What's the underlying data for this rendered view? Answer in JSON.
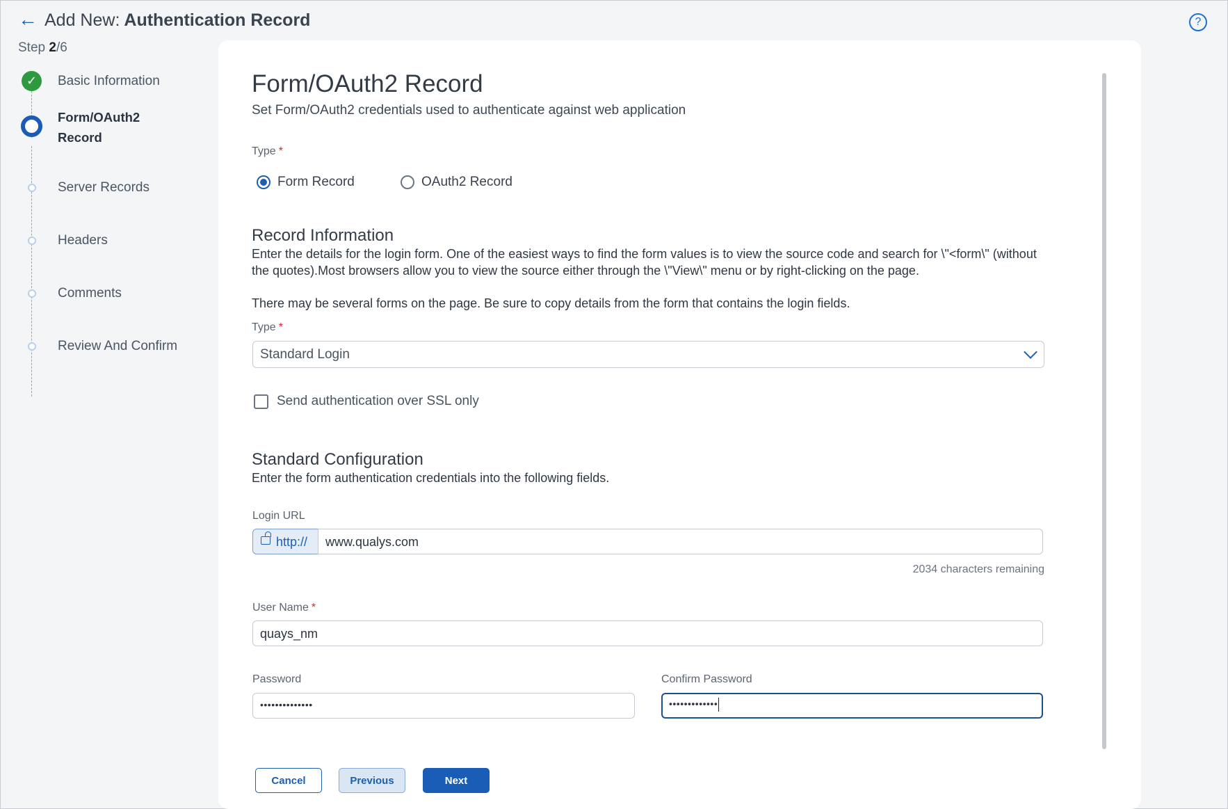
{
  "header": {
    "prefix": "Add New:",
    "title": "Authentication Record",
    "help_icon": "?"
  },
  "progress": {
    "step_word": "Step",
    "current": "2",
    "total": "/6"
  },
  "stepper": {
    "steps": [
      {
        "label": "Basic Information",
        "state": "done"
      },
      {
        "label_line1": "Form/OAuth2",
        "label_line2": "Record",
        "state": "active"
      },
      {
        "label": "Server Records",
        "state": "pending"
      },
      {
        "label": "Headers",
        "state": "pending"
      },
      {
        "label": "Comments",
        "state": "pending"
      },
      {
        "label": "Review And Confirm",
        "state": "pending"
      }
    ]
  },
  "main": {
    "title": "Form/OAuth2 Record",
    "subtitle": "Set Form/OAuth2 credentials used to authenticate against web application",
    "type_label": "Type",
    "type_options": [
      {
        "label": "Form Record",
        "selected": true
      },
      {
        "label": "OAuth2 Record",
        "selected": false
      }
    ],
    "record_info": {
      "heading": "Record Information",
      "para1": "Enter the details for the login form. One of the easiest ways to find the form values is to view the source code and search for \\\"<form\\\" (without the quotes).Most browsers allow you to view the source either through the \\\"View\\\" menu or by right-clicking on the page.",
      "para2": "There may be several forms on the page. Be sure to copy details from the form that contains the login fields.",
      "type_label": "Type",
      "type_value": "Standard Login",
      "ssl_label": "Send authentication over SSL only",
      "ssl_checked": false
    },
    "standard_config": {
      "heading": "Standard Configuration",
      "description": "Enter the form authentication credentials into the following fields.",
      "login_url_label": "Login URL",
      "protocol": "http://",
      "login_url_value": "www.qualys.com",
      "chars_remaining": "2034 characters remaining",
      "username_label": "User Name",
      "username_value": "quays_nm",
      "password_label": "Password",
      "password_value": "••••••••••••••",
      "confirm_password_label": "Confirm Password",
      "confirm_password_value": "•••••••••••••"
    }
  },
  "footer": {
    "cancel_label": "Cancel",
    "previous_label": "Previous",
    "next_label": "Next"
  },
  "colors": {
    "accent": "#1a5db6",
    "success": "#2d9a3f",
    "required": "#d9252c"
  }
}
